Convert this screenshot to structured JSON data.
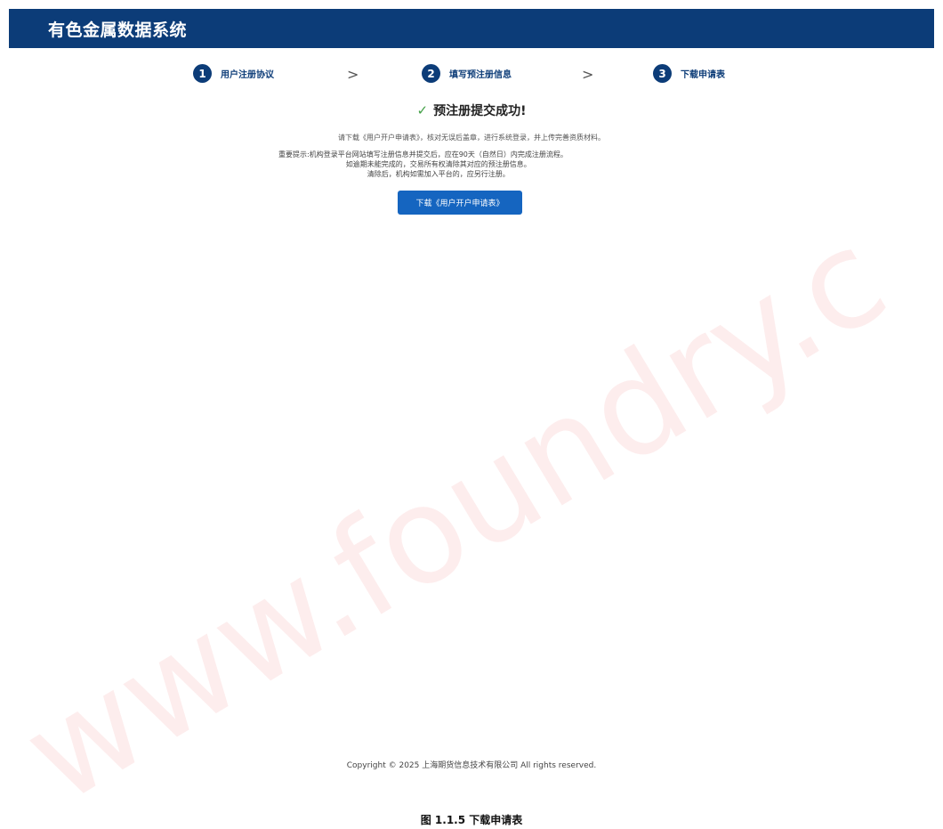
{
  "header": {
    "title": "有色金属数据系统"
  },
  "steps": [
    {
      "num": "1",
      "label": "用户注册协议"
    },
    {
      "num": "2",
      "label": "填写预注册信息"
    },
    {
      "num": "3",
      "label": "下载申请表"
    }
  ],
  "chevron": ">",
  "success": {
    "icon": "check-icon",
    "text": "预注册提交成功!"
  },
  "instruction": "请下载《用户开户申请表》，核对无误后盖章，进行系统登录，并上传完善资质材料。",
  "notice": {
    "label": "重要提示:",
    "lines": [
      "机构登录平台网站填写注册信息并提交后，应在90天（自然日）内完成注册流程。",
      "如逾期未能完成的，交易所有权清除其对应的预注册信息。",
      "清除后，机构如需加入平台的，应另行注册。"
    ]
  },
  "download_button": "下载《用户开户申请表》",
  "footer": {
    "copyright": "Copyright © 2025 上海期货信息技术有限公司 All rights reserved."
  },
  "caption": "图 1.1.5 下载申请表",
  "watermark": {
    "text": "www.foundry.c",
    "color": "#e53935"
  },
  "colors": {
    "header": "#0c3c78",
    "button": "#1565c0",
    "success_check": "#43a047"
  }
}
